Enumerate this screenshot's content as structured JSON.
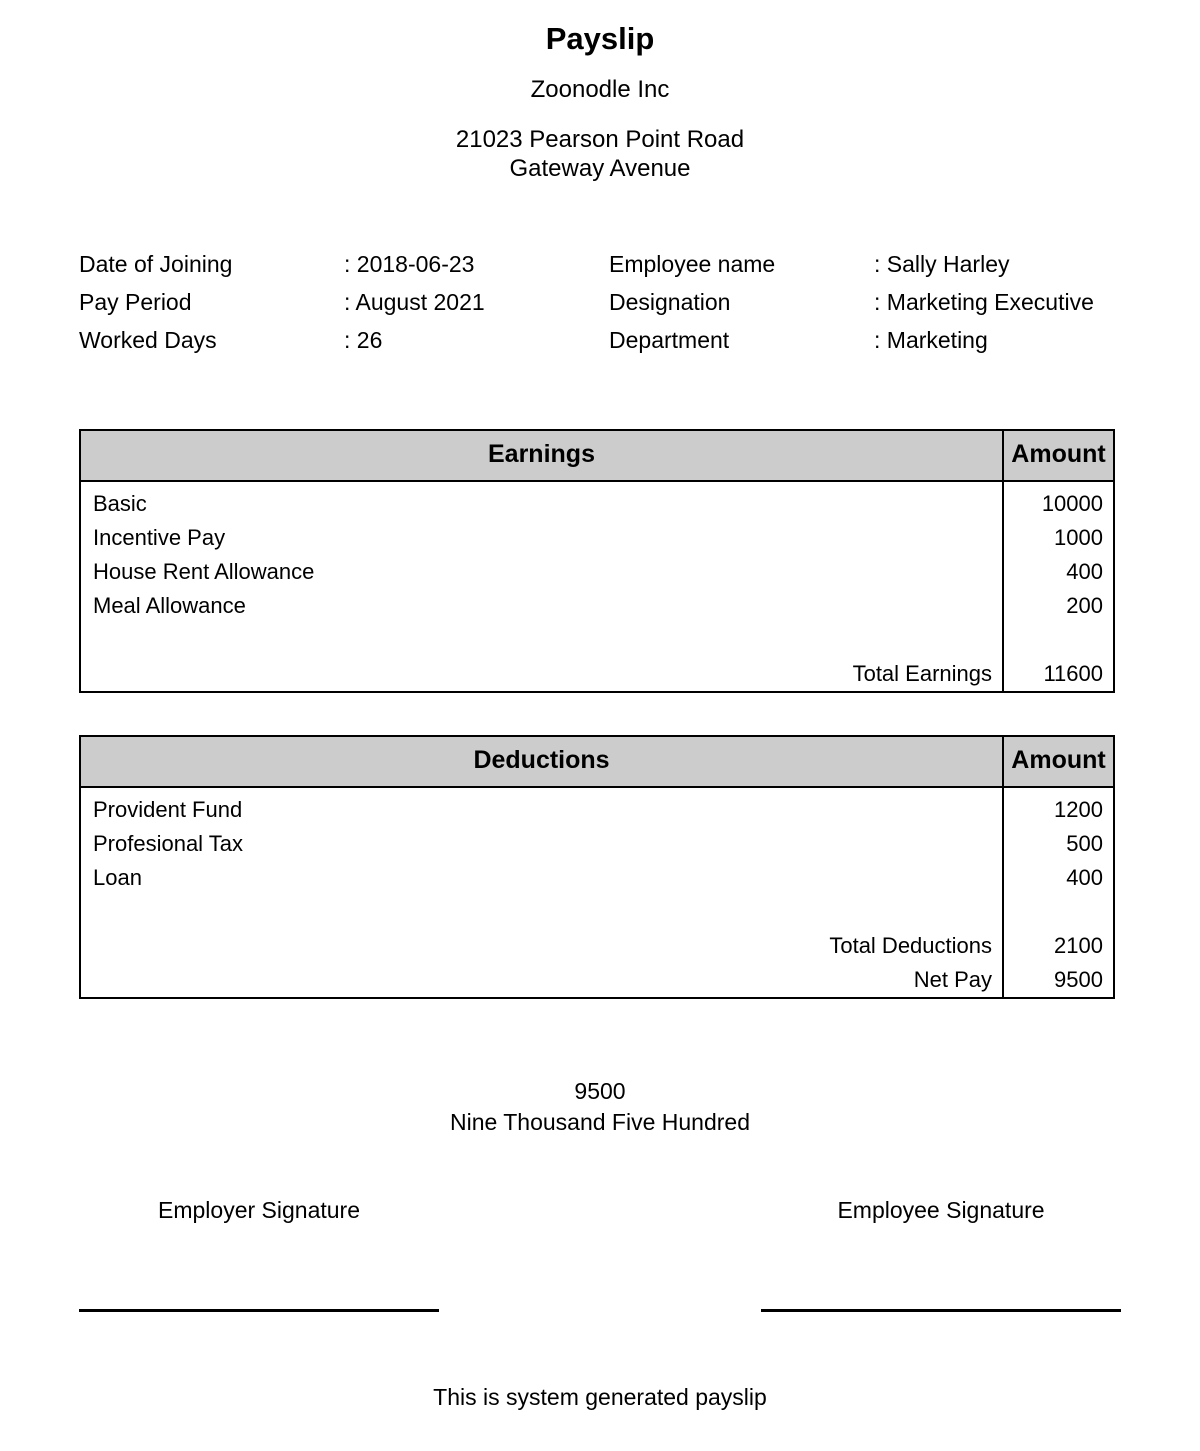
{
  "header": {
    "title": "Payslip",
    "company_name": "Zoonodle Inc",
    "address_line_1": "21023 Pearson Point Road",
    "address_line_2": "Gateway Avenue"
  },
  "employee_info": {
    "left": [
      {
        "label": "Date of Joining",
        "value": ": 2018-06-23"
      },
      {
        "label": "Pay Period",
        "value": ": August 2021"
      },
      {
        "label": "Worked Days",
        "value": ": 26"
      }
    ],
    "right": [
      {
        "label": "Employee name",
        "value": ": Sally Harley"
      },
      {
        "label": "Designation",
        "value": ": Marketing Executive"
      },
      {
        "label": "Department",
        "value": ": Marketing"
      }
    ]
  },
  "earnings": {
    "header_desc": "Earnings",
    "header_amount": "Amount",
    "rows": [
      {
        "desc": "Basic",
        "amount": "10000"
      },
      {
        "desc": "Incentive Pay",
        "amount": "1000"
      },
      {
        "desc": "House Rent Allowance",
        "amount": "400"
      },
      {
        "desc": "Meal Allowance",
        "amount": "200"
      }
    ],
    "totals": [
      {
        "desc": "Total Earnings",
        "amount": "11600"
      }
    ]
  },
  "deductions": {
    "header_desc": "Deductions",
    "header_amount": "Amount",
    "rows": [
      {
        "desc": "Provident Fund",
        "amount": "1200"
      },
      {
        "desc": "Profesional Tax",
        "amount": "500"
      },
      {
        "desc": "Loan",
        "amount": "400"
      }
    ],
    "totals": [
      {
        "desc": "Total Deductions",
        "amount": "2100"
      },
      {
        "desc": "Net Pay",
        "amount": "9500"
      }
    ]
  },
  "net_pay_summary": {
    "amount": "9500",
    "amount_in_words": "Nine Thousand Five Hundred"
  },
  "signatures": {
    "employer_label": "Employer Signature",
    "employee_label": "Employee Signature"
  },
  "footer": {
    "note": "This is system generated payslip"
  },
  "colors": {
    "header_fill": "#cccccc",
    "border": "#000000",
    "text": "#000000",
    "background": "#ffffff"
  }
}
